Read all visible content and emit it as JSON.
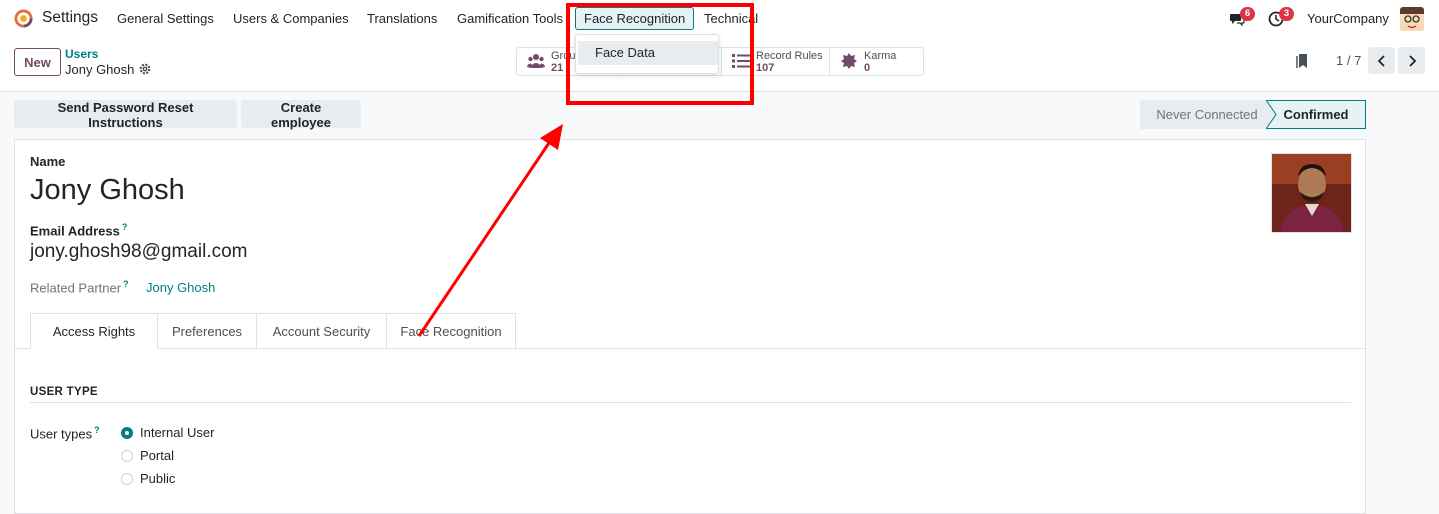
{
  "navbar": {
    "app_name": "Settings",
    "menu": [
      {
        "label": "General Settings"
      },
      {
        "label": "Users & Companies"
      },
      {
        "label": "Translations"
      },
      {
        "label": "Gamification Tools"
      },
      {
        "label": "Face Recognition"
      },
      {
        "label": "Technical"
      }
    ],
    "messages_count": "6",
    "activities_count": "3",
    "company": "YourCompany"
  },
  "dropdown": {
    "items": [
      {
        "label": "Face Data"
      }
    ]
  },
  "control_panel": {
    "new_label": "New",
    "breadcrumb_parent": "Users",
    "breadcrumb_current": "Jony Ghosh",
    "smart_buttons": [
      {
        "label": "Grou",
        "value": "21",
        "icon": "users-icon"
      },
      {
        "label": "",
        "value": "",
        "icon": "hidden"
      },
      {
        "label": "Record Rules",
        "value": "107",
        "icon": "list-icon"
      },
      {
        "label": "Karma",
        "value": "0",
        "icon": "badge-icon"
      }
    ],
    "pager": "1 / 7"
  },
  "actions": {
    "reset_password": "Send Password Reset Instructions",
    "create_employee": "Create employee"
  },
  "status": {
    "never_connected": "Never Connected",
    "confirmed": "Confirmed"
  },
  "form": {
    "name_label": "Name",
    "name_value": "Jony Ghosh",
    "email_label": "Email Address",
    "email_value": "jony.ghosh98@gmail.com",
    "partner_label": "Related Partner",
    "partner_value": "Jony Ghosh",
    "help_mark": "?",
    "tabs": [
      {
        "label": "Access Rights"
      },
      {
        "label": "Preferences"
      },
      {
        "label": "Account Security"
      },
      {
        "label": "Face Recognition"
      }
    ],
    "section_title": "USER TYPE",
    "user_types_label": "User types",
    "user_types": [
      {
        "label": "Internal User",
        "checked": true
      },
      {
        "label": "Portal",
        "checked": false
      },
      {
        "label": "Public",
        "checked": false
      }
    ]
  },
  "colors": {
    "primary": "#714b67",
    "accent": "#017e84",
    "annotation": "#ff0000"
  }
}
